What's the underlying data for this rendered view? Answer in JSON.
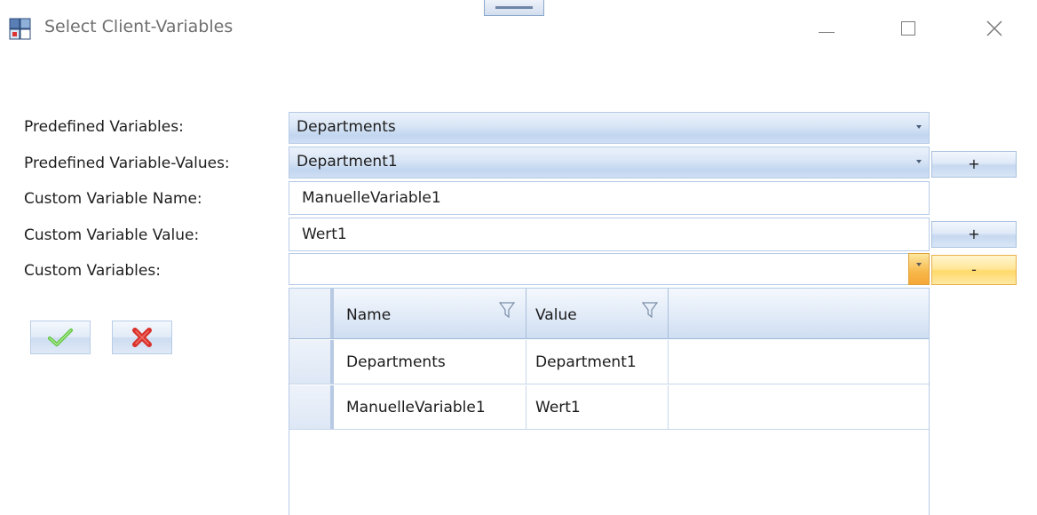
{
  "window": {
    "title": "Select Client-Variables",
    "minimize_icon": "minimize-icon",
    "maximize_icon": "maximize-icon",
    "close_icon": "close-icon",
    "app_icon": "app-window-icon"
  },
  "form": {
    "predefined_variables_label": "Predefined Variables:",
    "predefined_variables_value": "Departments",
    "predefined_values_label": "Predefined Variable-Values:",
    "predefined_values_value": "Department1",
    "custom_name_label": "Custom Variable Name:",
    "custom_name_value": "ManuelleVariable1",
    "custom_value_label": "Custom Variable Value:",
    "custom_value_value": "Wert1",
    "custom_variables_label": "Custom Variables:",
    "custom_variables_value": "",
    "add_predefined_label": "+",
    "add_custom_label": "+",
    "remove_custom_label": "-"
  },
  "actions": {
    "ok_icon": "checkmark-icon",
    "cancel_icon": "red-x-icon"
  },
  "grid": {
    "columns": [
      "Name",
      "Value"
    ],
    "rows": [
      [
        "Departments",
        "Department1"
      ],
      [
        "ManuelleVariable1",
        "Wert1"
      ]
    ]
  },
  "colors": {
    "accent_blue": "#c2d6f0",
    "hot_orange": "#f7b84a",
    "ok_green": "#5cc43a",
    "cancel_red": "#d9312a"
  }
}
